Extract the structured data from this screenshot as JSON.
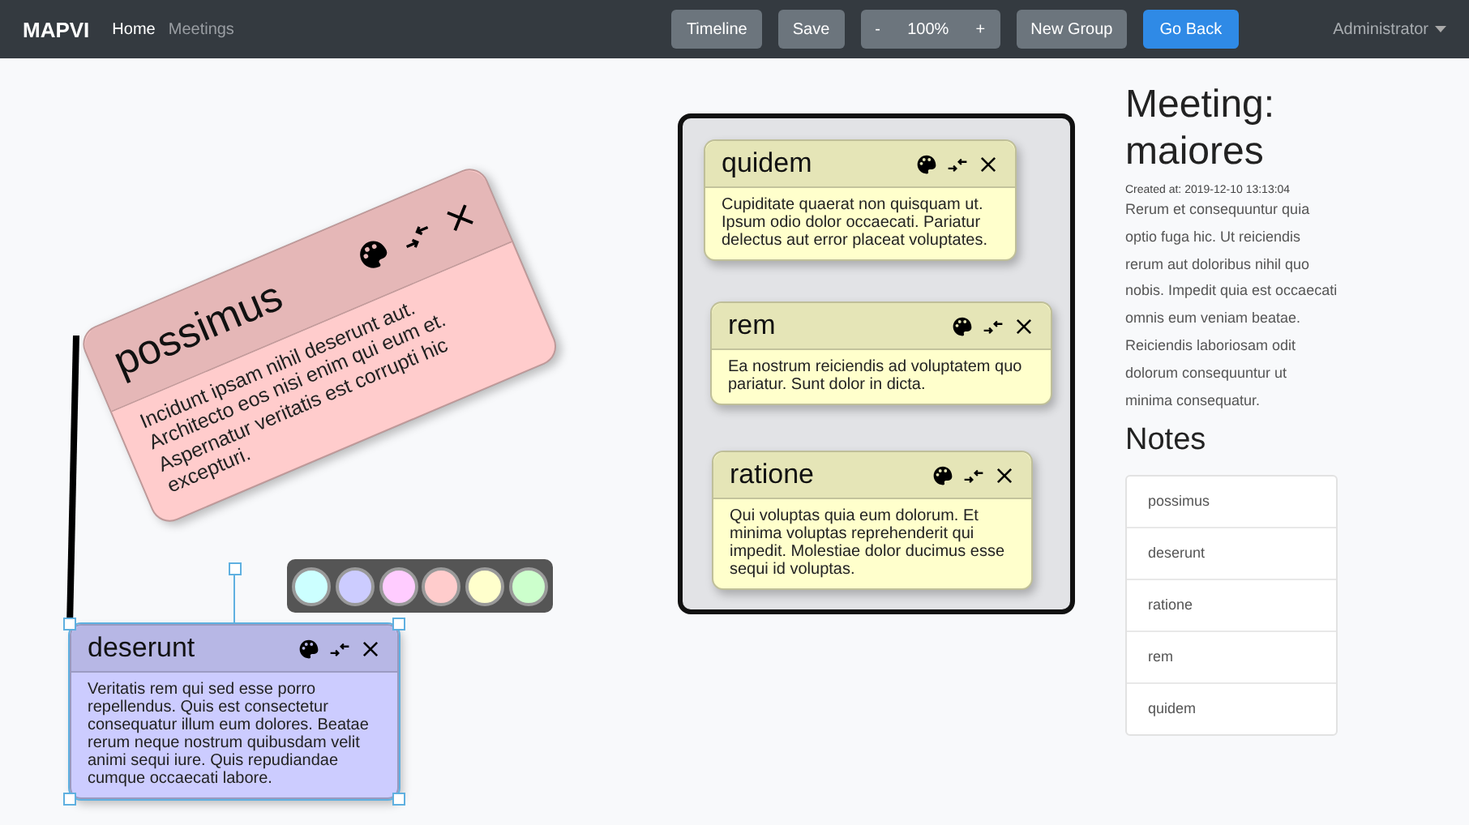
{
  "navbar": {
    "brand": "MAPVI",
    "links": [
      {
        "label": "Home",
        "selected": true
      },
      {
        "label": "Meetings",
        "selected": false
      }
    ],
    "buttons": [
      {
        "kind": "plain",
        "label": "Timeline"
      },
      {
        "kind": "plain",
        "label": "Save"
      },
      {
        "kind": "zoom",
        "minus": "-",
        "value": "100%",
        "plus": "+"
      },
      {
        "kind": "plain",
        "label": "New Group"
      },
      {
        "kind": "primary",
        "label": "Go Back"
      }
    ],
    "user_menu": "Administrator"
  },
  "canvas_notes": [
    {
      "title": "possimus",
      "body": "Incidunt ipsam nihil deserunt aut. Architecto eos nisi enim qui eum et. Aspernatur veritatis est corrupti hic excepturi.",
      "color": "#ffcccc",
      "selected": false
    },
    {
      "title": "deserunt",
      "body": "Veritatis rem qui sed esse porro repellendus. Quis est consectetur consequatur illum eum dolores. Beatae rerum neque nostrum quibusdam velit animi sequi iure. Quis repudiandae cumque occaecati labore.",
      "color": "#ccccff",
      "selected": true
    }
  ],
  "palette": [
    {
      "color": "#ccffff"
    },
    {
      "color": "#ccccff"
    },
    {
      "color": "#ffccff"
    },
    {
      "color": "#ffcccc"
    },
    {
      "color": "#ffffcc"
    },
    {
      "color": "#ccffcc"
    }
  ],
  "group": {
    "notes": [
      {
        "title": "quidem",
        "body": "Cupiditate quaerat non quisquam ut. Ipsum odio dolor occaecati. Pariatur delectus aut error placeat voluptates.",
        "color": "#ffffcc",
        "selected": false
      },
      {
        "title": "rem",
        "body": "Ea nostrum reiciendis ad voluptatem quo pariatur. Sunt dolor in dicta.",
        "color": "#ffffcc",
        "selected": false
      },
      {
        "title": "ratione",
        "body": "Qui voluptas quia eum dolorum. Et minima voluptas reprehenderit qui impedit. Molestiae dolor ducimus esse sequi id voluptas.",
        "color": "#ffffcc",
        "selected": false
      }
    ]
  },
  "sidebar": {
    "title": "Meeting: maiores",
    "created": "Created at: 2019-12-10 13:13:04",
    "description": "Rerum et consequuntur quia optio fuga hic. Ut reiciendis rerum aut doloribus nihil quo nobis. Impedit quia est occaecati omnis eum veniam beatae. Reiciendis laboriosam odit dolorum consequuntur ut minima consequatur.",
    "notes_heading": "Notes",
    "notes": [
      "possimus",
      "deserunt",
      "ratione",
      "rem",
      "quidem"
    ]
  }
}
